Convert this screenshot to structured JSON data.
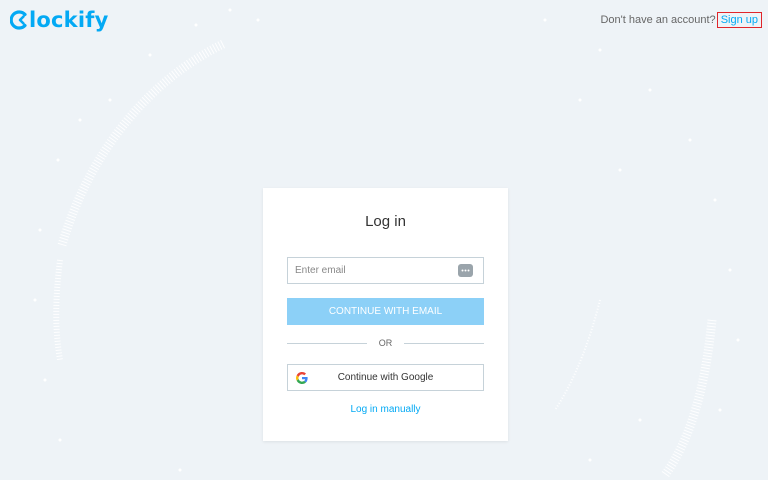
{
  "brand": {
    "name": "lockify",
    "accent": "#03a9f4"
  },
  "header": {
    "account_prompt": "Don't have an account?",
    "signup_label": "Sign up"
  },
  "card": {
    "title": "Log in",
    "email_placeholder": "Enter email",
    "continue_email_label": "CONTINUE WITH EMAIL",
    "or_label": "OR",
    "google_label": "Continue with Google",
    "manual_label": "Log in manually"
  },
  "icons": {
    "logo": "clockify-logo-icon",
    "password_manager": "password-manager-icon",
    "google": "google-g-icon"
  }
}
